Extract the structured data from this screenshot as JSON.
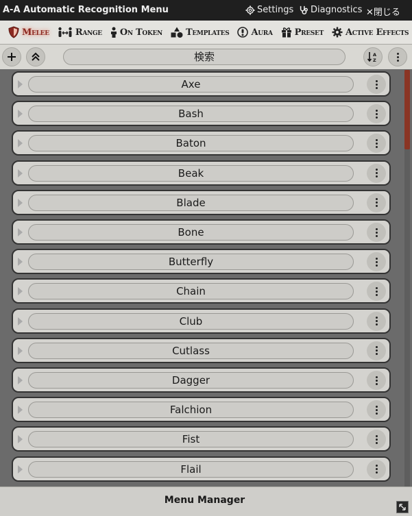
{
  "window": {
    "title": "A-A Automatic Recognition Menu",
    "settings_label": "Settings",
    "diagnostics_label": "Diagnostics",
    "close_label": "✕閉じる"
  },
  "tabs": [
    {
      "label": "Melee",
      "icon": "shield-icon",
      "active": true
    },
    {
      "label": "Range",
      "icon": "people-arrows-icon",
      "active": false
    },
    {
      "label": "On Token",
      "icon": "person-icon",
      "active": false
    },
    {
      "label": "Templates",
      "icon": "shapes-icon",
      "active": false
    },
    {
      "label": "Aura",
      "icon": "aura-icon",
      "active": false
    },
    {
      "label": "Preset",
      "icon": "gift-icon",
      "active": false
    },
    {
      "label": "Active Effects",
      "icon": "gear-icon",
      "active": false
    }
  ],
  "toolbar": {
    "search_placeholder": "検索",
    "add_icon": "plus-icon",
    "collapse_icon": "double-chevron-up-icon",
    "sort_icon": "sort-alpha-icon",
    "menu_icon": "vertical-dots-icon"
  },
  "items": [
    {
      "name": "Axe"
    },
    {
      "name": "Bash"
    },
    {
      "name": "Baton"
    },
    {
      "name": "Beak"
    },
    {
      "name": "Blade"
    },
    {
      "name": "Bone"
    },
    {
      "name": "Butterfly"
    },
    {
      "name": "Chain"
    },
    {
      "name": "Club"
    },
    {
      "name": "Cutlass"
    },
    {
      "name": "Dagger"
    },
    {
      "name": "Falchion"
    },
    {
      "name": "Fist"
    },
    {
      "name": "Flail"
    }
  ],
  "footer": {
    "label": "Menu Manager"
  },
  "colors": {
    "accent": "#8c2a22",
    "scrollbar_thumb": "#8a3524"
  }
}
